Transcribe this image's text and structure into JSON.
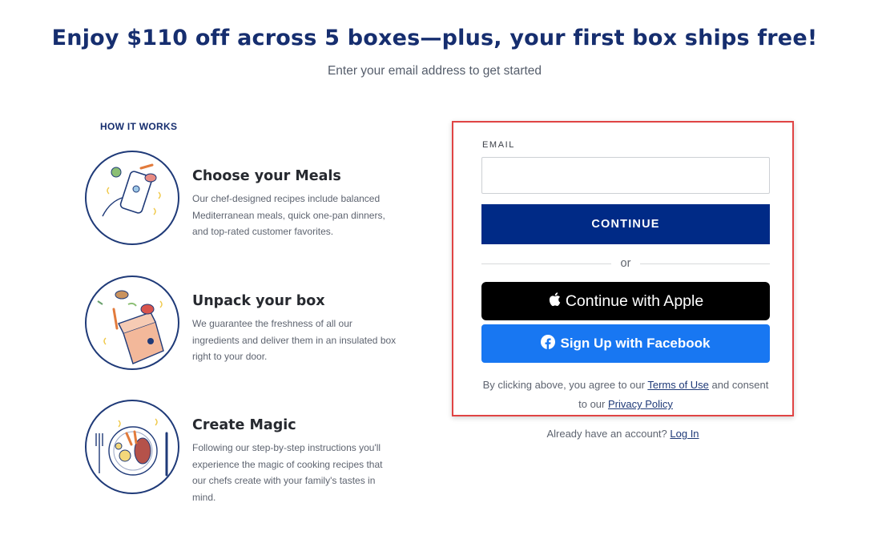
{
  "header": {
    "title": "Enjoy $110 off across 5 boxes—plus, your first box ships free!",
    "subtitle": "Enter your email address to get started"
  },
  "how_it_works": {
    "heading": "HOW IT WORKS",
    "steps": [
      {
        "title": "Choose your Meals",
        "body": "Our chef-designed recipes include balanced Mediterranean meals, quick one-pan dinners, and top-rated customer favorites.",
        "icon": "phone-recipes-illustration"
      },
      {
        "title": "Unpack your box",
        "body": "We guarantee the freshness of all our ingredients and deliver them in an insulated box right to your door.",
        "icon": "delivery-box-illustration"
      },
      {
        "title": "Create Magic",
        "body": "Following our step-by-step instructions you'll experience the magic of cooking recipes that our chefs create with your family's tastes in mind.",
        "icon": "plated-meal-illustration"
      }
    ]
  },
  "signup": {
    "email_label": "EMAIL",
    "email_value": "",
    "continue_label": "CONTINUE",
    "or_label": "or",
    "apple_label": "Continue with Apple",
    "facebook_label": "Sign Up with Facebook",
    "legal_prefix": "By clicking above, you agree to our ",
    "terms_link": "Terms of Use",
    "legal_middle": " and consent to our ",
    "privacy_link": "Privacy Policy"
  },
  "login": {
    "prompt": "Already have an account? ",
    "link": "Log In"
  },
  "colors": {
    "brand_navy": "#002a86",
    "heading_navy": "#162e6f",
    "facebook_blue": "#1877f2",
    "apple_black": "#000000",
    "highlight_border": "#e04444"
  }
}
